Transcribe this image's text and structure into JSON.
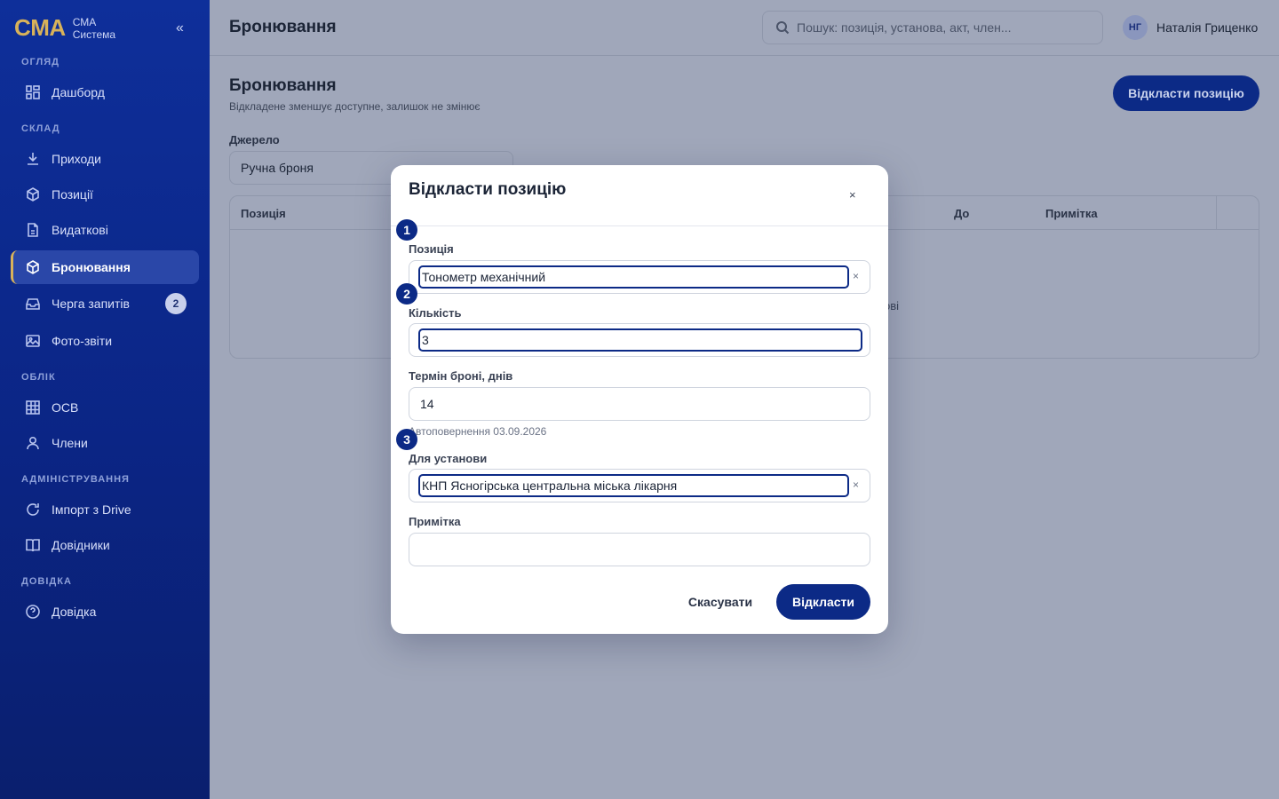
{
  "sidebar": {
    "brand_logo": "CMA",
    "brand_line1": "СМА",
    "brand_line2": "Система",
    "collapse_icon": "«",
    "sections": {
      "overview": "ОГЛЯД",
      "warehouse": "СКЛАД",
      "accounting": "ОБЛІК",
      "admin": "АДМІНІСТРУВАННЯ",
      "help": "ДОВІДКА"
    },
    "items": [
      {
        "label": "Дашборд",
        "icon": "dashboard-icon"
      },
      {
        "label": "Приходи",
        "icon": "download-icon"
      },
      {
        "label": "Позиції",
        "icon": "box-icon"
      },
      {
        "label": "Видаткові",
        "icon": "document-icon"
      },
      {
        "label": "Бронювання",
        "icon": "box-icon",
        "active": true
      },
      {
        "label": "Черга запитів",
        "icon": "inbox-icon",
        "badge": "2"
      },
      {
        "label": "Фото-звіти",
        "icon": "image-icon"
      },
      {
        "label": "ОСВ",
        "icon": "grid-icon"
      },
      {
        "label": "Члени",
        "icon": "user-icon"
      },
      {
        "label": "Імпорт з Drive",
        "icon": "refresh-icon"
      },
      {
        "label": "Довідники",
        "icon": "book-icon"
      },
      {
        "label": "Довідка",
        "icon": "help-icon"
      }
    ]
  },
  "header": {
    "title": "Бронювання",
    "search_placeholder": "Пошук: позиція, установа, акт, член...",
    "user_initials": "НГ",
    "user_name": "Наталія Гриценко"
  },
  "main": {
    "title": "Бронювання",
    "subtitle": "Відкладене зменшує доступне, залишок не змінює",
    "action_button": "Відкласти позицію",
    "source_label": "Джерело",
    "source_value": "Ручна броня",
    "table_headers": {
      "position": "Позиція",
      "until": "До",
      "note": "Примітка"
    },
    "empty_fragment": "ові"
  },
  "modal": {
    "title": "Відкласти позицію",
    "close": "×",
    "fields": {
      "position": {
        "label": "Позиція",
        "value": "Тонометр механічний"
      },
      "quantity": {
        "label": "Кількість",
        "value": "3"
      },
      "term": {
        "label": "Термін броні, днів",
        "value": "14"
      },
      "term_hint": "Автоповернення 03.09.2026",
      "institution": {
        "label": "Для установи",
        "value": "КНП Ясногірська центральна міська лікарня"
      },
      "note": {
        "label": "Примітка",
        "value": ""
      }
    },
    "clear_symbol": "×",
    "markers": [
      "1",
      "2",
      "3"
    ],
    "cancel": "Скасувати",
    "submit": "Відкласти"
  },
  "colors": {
    "sidebar": "#0e2f9a",
    "accent_gold": "#d8b25a",
    "primary": "#0c2a86",
    "overlay": "#a0a7ba"
  }
}
